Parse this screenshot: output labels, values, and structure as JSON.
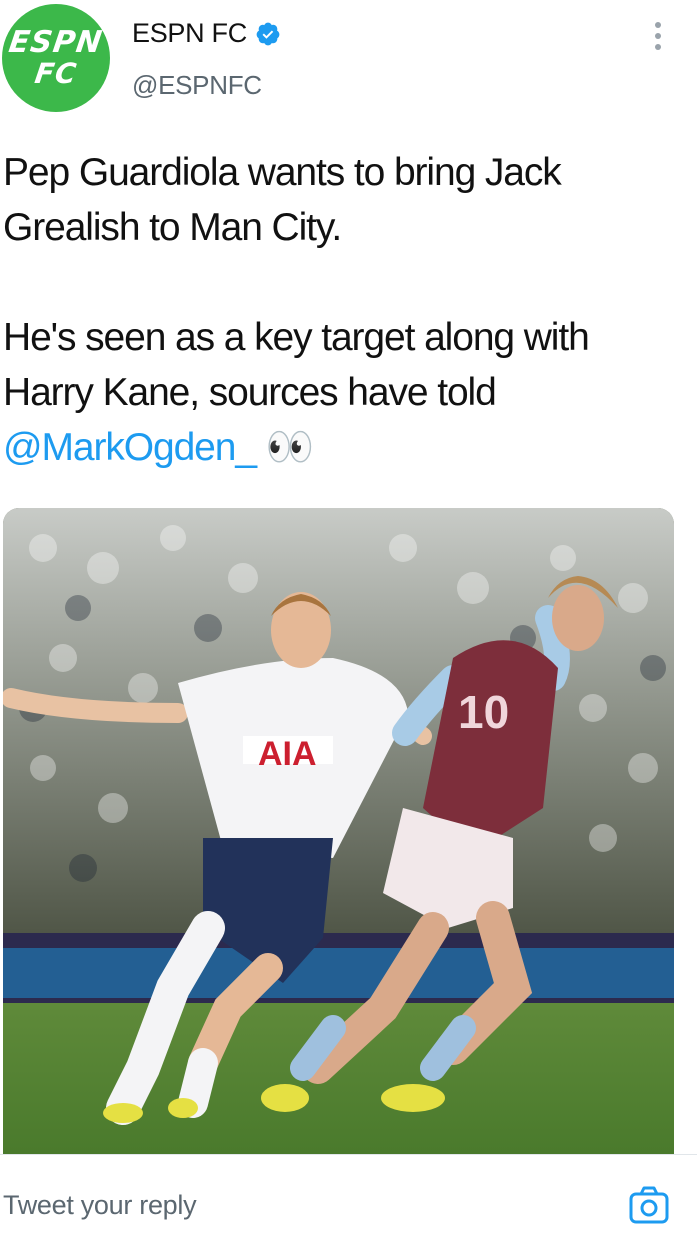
{
  "account": {
    "display_name": "ESPN FC",
    "handle": "@ESPNFC",
    "avatar_text_line1": "ESPN",
    "avatar_text_line2": "FC",
    "verified": true
  },
  "tweet": {
    "paragraph1": "Pep Guardiola wants to bring Jack Grealish to Man City.",
    "paragraph2_text": "He's seen as a key target along with Harry Kane, sources have told",
    "mention": "@MarkOgden_",
    "emoji": "👀"
  },
  "media": {
    "type": "photo",
    "jersey_sponsor": "AIA",
    "jersey_number": "10"
  },
  "reply": {
    "placeholder": "Tweet your reply"
  },
  "icons": {
    "verified": "verified-badge-icon",
    "more": "more-vertical-icon",
    "camera": "camera-icon"
  },
  "colors": {
    "link": "#1d9bf0",
    "avatar_bg": "#3cb84a",
    "secondary_text": "#5b6770"
  }
}
